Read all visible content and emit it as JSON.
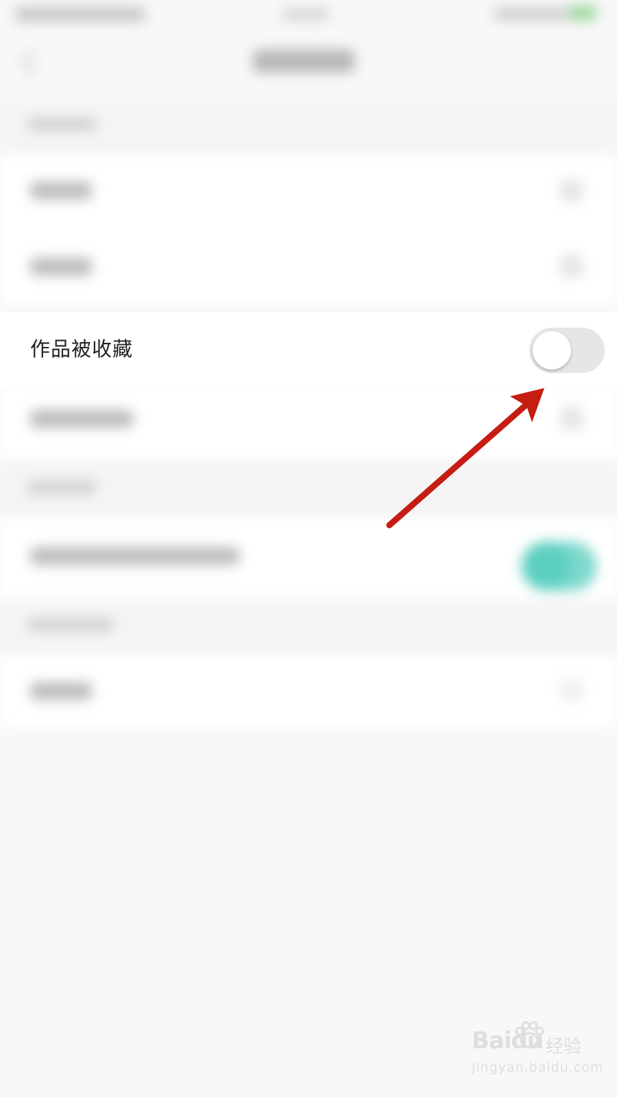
{
  "setting": {
    "label": "作品被收藏",
    "enabled": false
  },
  "watermark": {
    "brand": "Baidu",
    "sub": "经验",
    "url": "jingyan.baidu.com"
  },
  "colors": {
    "annotation_arrow": "#c61d12",
    "toggle_off": "#e6e6e6",
    "toggle_on_blurred": "#5ccfc0"
  }
}
